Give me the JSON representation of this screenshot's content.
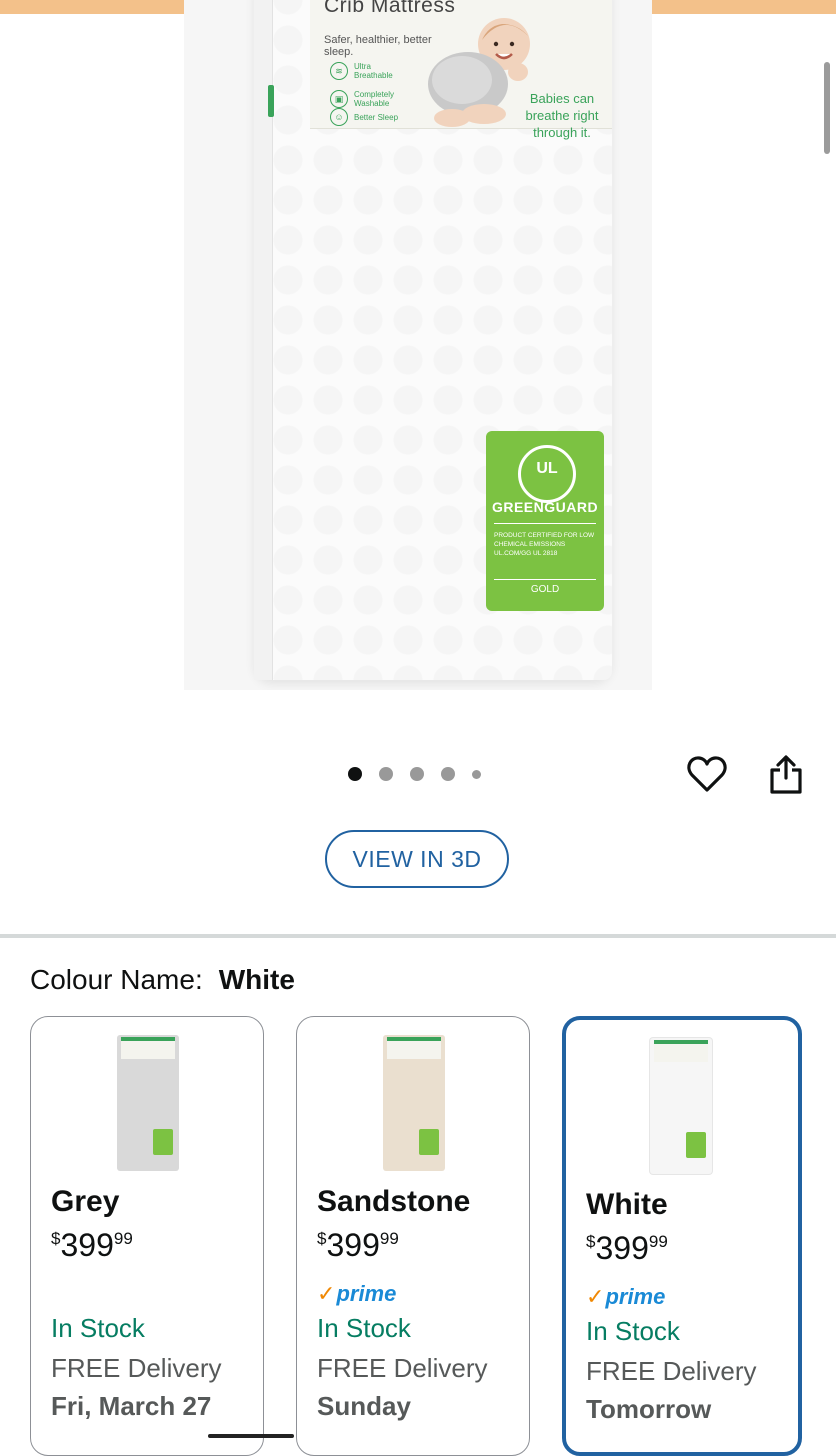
{
  "product_image": {
    "label_title": "Crib Mattress",
    "label_tagline": "Safer, healthier, better sleep.",
    "features": [
      "Ultra Breathable",
      "Completely Washable",
      "Better Sleep"
    ],
    "claim": "Babies can breathe right through it.",
    "badge": {
      "logo": "UL",
      "title": "GREENGUARD",
      "text": "PRODUCT CERTIFIED FOR LOW CHEMICAL EMISSIONS UL.COM/GG UL 2818",
      "level": "GOLD"
    }
  },
  "carousel": {
    "dot_count": 5,
    "active_index": 0
  },
  "actions": {
    "favorite_icon": "heart-icon",
    "share_icon": "share-icon"
  },
  "view_3d": {
    "label": "VIEW IN 3D"
  },
  "colour": {
    "label": "Colour Name:",
    "selected": "White"
  },
  "swatches": [
    {
      "name": "Grey",
      "currency": "$",
      "price_whole": "399",
      "price_fraction": "99",
      "prime": false,
      "stock": "In Stock",
      "delivery": "FREE Delivery",
      "delivery_date": "Fri, March 27",
      "thumb_color": "#d9d9d9"
    },
    {
      "name": "Sandstone",
      "currency": "$",
      "price_whole": "399",
      "price_fraction": "99",
      "prime": true,
      "prime_label": "prime",
      "stock": "In Stock",
      "delivery": "FREE Delivery",
      "delivery_date": "Sunday",
      "thumb_color": "#eadfcf"
    },
    {
      "name": "White",
      "currency": "$",
      "price_whole": "399",
      "price_fraction": "99",
      "prime": true,
      "prime_label": "prime",
      "stock": "In Stock",
      "delivery": "FREE Delivery",
      "delivery_date": "Tomorrow",
      "thumb_color": "#f6f6f6",
      "selected": true
    }
  ],
  "colors": {
    "accent": "#2162a1",
    "stock_green": "#067d62",
    "prime_blue": "#1a8ad6",
    "prime_check": "#f08804"
  }
}
